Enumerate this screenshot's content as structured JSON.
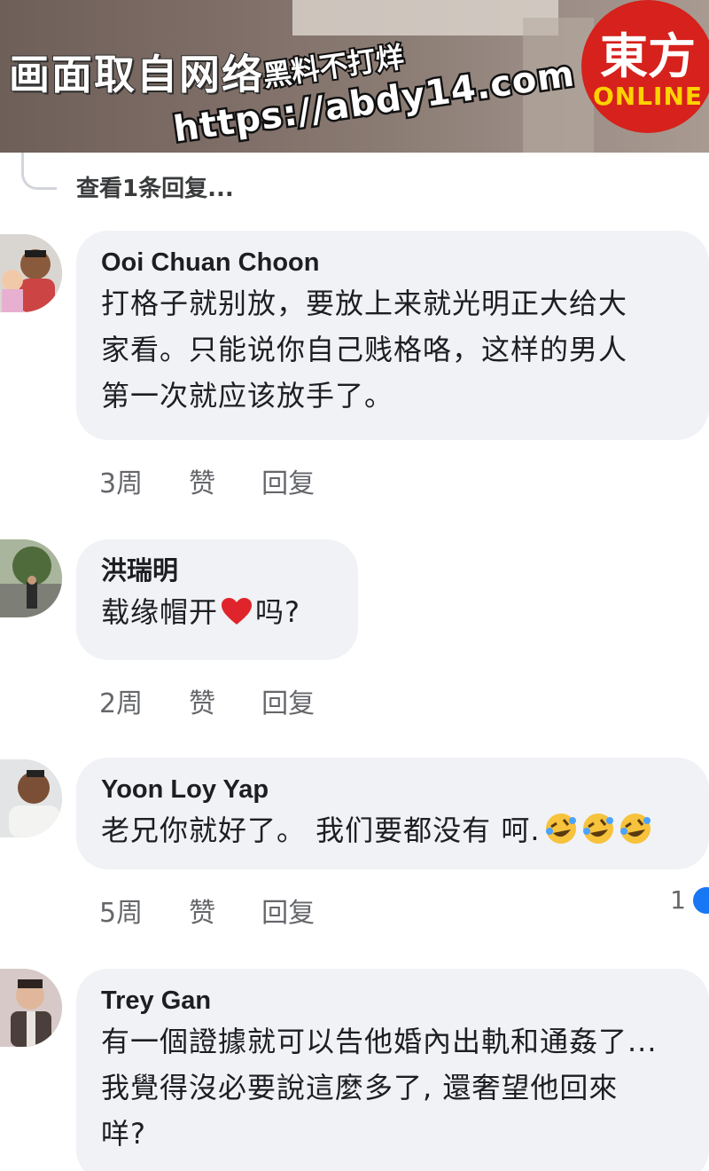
{
  "banner": {
    "caption": "画面取自网络",
    "watermark_line1": "黑料不打烊",
    "watermark_line2": "https://abdy14.com",
    "logo_main": "東方",
    "logo_sub": "ONLINE",
    "logo_color": "#d6211c"
  },
  "thread": {
    "view_replies": "查看1条回复..."
  },
  "actions": {
    "like": "赞",
    "reply": "回复"
  },
  "comments": [
    {
      "author": "Ooi Chuan Choon",
      "lines": [
        "打格子就别放，要放上来就光明正大给大",
        "家看。只能说你自己贱格咯，这样的男人",
        "第一次就应该放手了。"
      ],
      "time": "3周"
    },
    {
      "author": "洪瑞明",
      "text_before": "载缘帽开",
      "text_after": "吗?",
      "inline_icon": "red-heart-icon",
      "time": "2周"
    },
    {
      "author": "Yoon Loy Yap",
      "text": "老兄你就好了。 我们要都没有 呵.",
      "inline_icons": [
        "rolling-laughing-icon",
        "rolling-laughing-icon",
        "rolling-laughing-icon"
      ],
      "time": "5周",
      "reaction_count": "1",
      "reaction_icon": "like-icon"
    },
    {
      "author": "Trey Gan",
      "lines": [
        "有一個證據就可以告他婚內出軌和通姦了...",
        "我覺得沒必要說這麼多了, 還奢望他回來",
        "咩?"
      ]
    }
  ],
  "colors": {
    "bubble": "#f0f2f5",
    "meta_text": "#65676b",
    "like_blue": "#1877f2"
  }
}
